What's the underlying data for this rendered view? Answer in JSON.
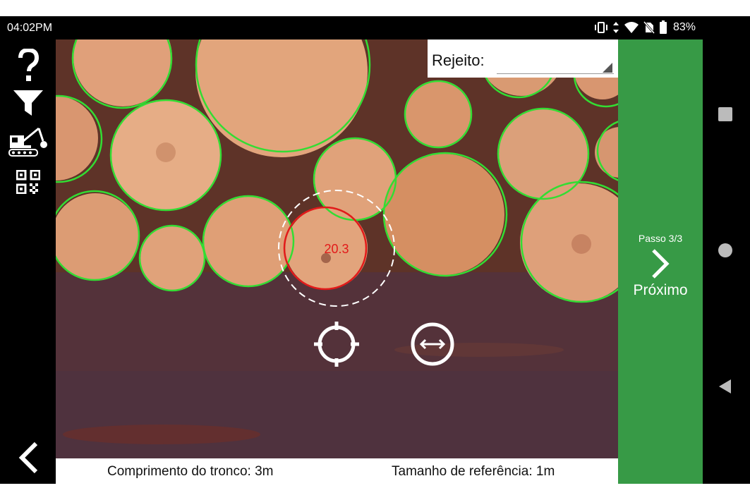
{
  "status_bar": {
    "time": "04:02PM",
    "battery": "83%",
    "icons": [
      "vibrate-icon",
      "data-arrows-icon",
      "wifi-icon",
      "no-sim-icon",
      "battery-icon"
    ]
  },
  "left_toolbar": {
    "items": [
      "help-icon",
      "filter-icon",
      "excavator-icon",
      "qr-code-icon"
    ],
    "back": "back-arrow-icon"
  },
  "reject": {
    "label": "Rejeito:",
    "value": ""
  },
  "measurement": {
    "selected_diameter": "20.3",
    "tools": [
      "target-crosshair-icon",
      "resize-horizontal-icon"
    ]
  },
  "bottom_info": {
    "length": "Comprimento do tronco: 3m",
    "reference": "Tamanho de referência: 1m"
  },
  "next_panel": {
    "step": "Passo 3/3",
    "label": "Próximo"
  },
  "nav": [
    "recents-square-icon",
    "home-circle-icon",
    "back-triangle-icon"
  ],
  "colors": {
    "accent_green": "#379a46",
    "detected_circle": "#33dd33",
    "selected_circle": "#e21a1a"
  }
}
